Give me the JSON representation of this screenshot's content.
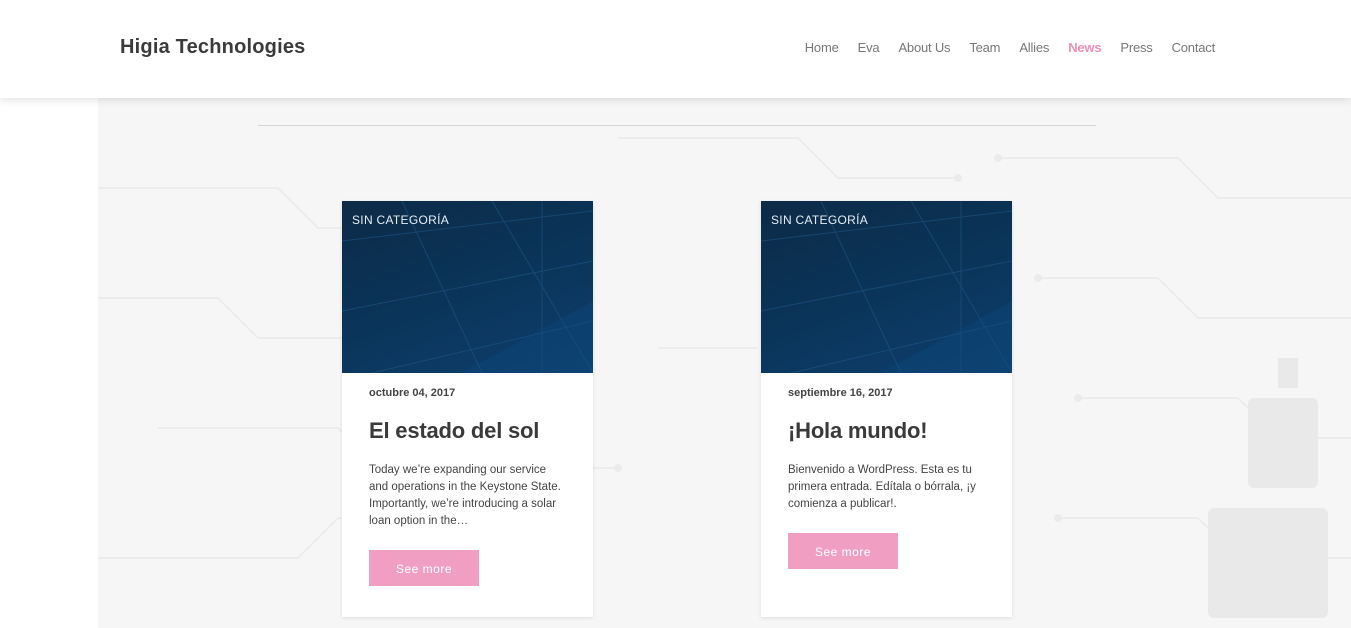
{
  "header": {
    "brand": "Higia Technologies",
    "nav": [
      {
        "label": "Home",
        "active": false
      },
      {
        "label": "Eva",
        "active": false
      },
      {
        "label": "About Us",
        "active": false
      },
      {
        "label": "Team",
        "active": false
      },
      {
        "label": "Allies",
        "active": false
      },
      {
        "label": "News",
        "active": true
      },
      {
        "label": "Press",
        "active": false
      },
      {
        "label": "Contact",
        "active": false
      }
    ]
  },
  "colors": {
    "accent": "#ee8fb8",
    "button": "#f09fc3",
    "thumbnail": "#0a3357"
  },
  "posts": [
    {
      "category": "SIN CATEGORÍA",
      "date": "octubre 04, 2017",
      "title": "El estado del sol",
      "excerpt": "Today we’re expanding our service and operations in the Keystone State. Importantly, we’re introducing a solar loan option in the…",
      "button": "See more"
    },
    {
      "category": "SIN CATEGORÍA",
      "date": "septiembre 16, 2017",
      "title": "¡Hola mundo!",
      "excerpt": "Bienvenido a WordPress. Esta es tu primera entrada. Edítala o bórrala, ¡y comienza a publicar!.",
      "button": "See more"
    }
  ]
}
